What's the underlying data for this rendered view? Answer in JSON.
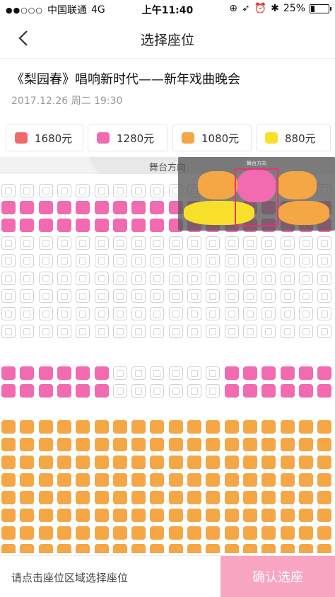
{
  "status": {
    "signal": "●●○○○",
    "carrier": "中国联通",
    "network": "4G",
    "time": "上午11:40",
    "battery": "25%"
  },
  "nav": {
    "back_icon": "chevron-left-icon",
    "title": "选择座位"
  },
  "show": {
    "title": "《梨园春》唱响新时代——新年戏曲晚会",
    "datetime": "2017.12.26 周二 19:30"
  },
  "prices": [
    {
      "label": "1680元",
      "color": "#f06a6a"
    },
    {
      "label": "1280元",
      "color": "#f26ab0"
    },
    {
      "label": "1080元",
      "color": "#f5a645"
    },
    {
      "label": "880元",
      "color": "#f8e02a"
    }
  ],
  "stage": {
    "label": "舞台方向"
  },
  "minimap": {
    "stage_label": "舞台方向"
  },
  "footer": {
    "hint": "请点击座位区域选择座位",
    "confirm_label": "确认选座"
  },
  "colors": {
    "pink": "#f26ab0",
    "orange": "#f5a645",
    "accent": "#e8336f"
  }
}
